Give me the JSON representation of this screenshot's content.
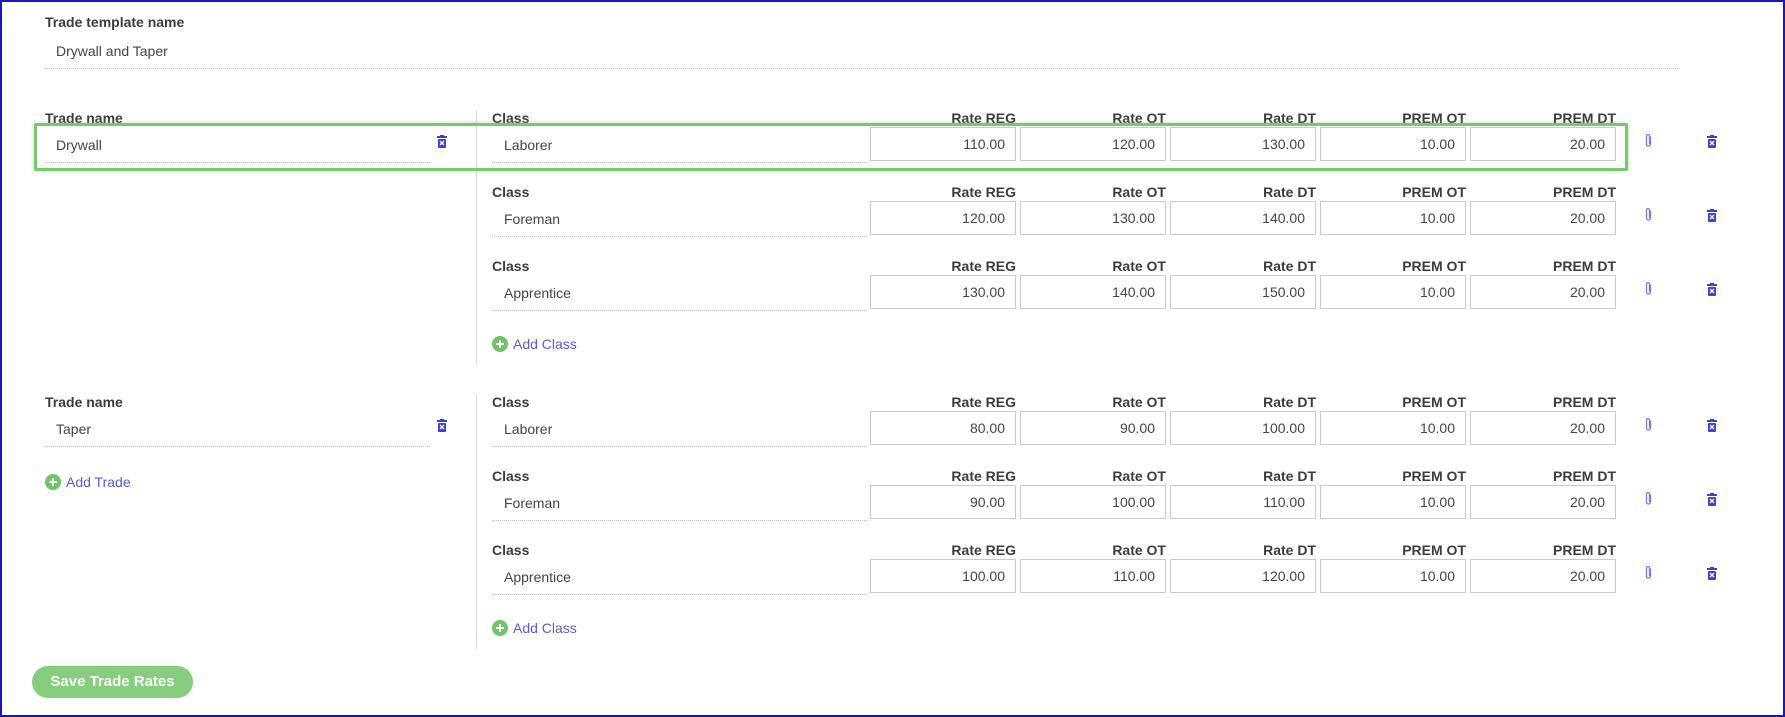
{
  "template": {
    "name_label": "Trade template name",
    "name_value": "Drywall and Taper"
  },
  "labels": {
    "trade_name": "Trade name",
    "class": "Class",
    "rate_reg": "Rate REG",
    "rate_ot": "Rate OT",
    "rate_dt": "Rate DT",
    "prem_ot": "PREM OT",
    "prem_dt": "PREM DT"
  },
  "trades": [
    {
      "name": "Drywall",
      "classes": [
        {
          "name": "Laborer",
          "rate_reg": "110.00",
          "rate_ot": "120.00",
          "rate_dt": "130.00",
          "prem_ot": "10.00",
          "prem_dt": "20.00"
        },
        {
          "name": "Foreman",
          "rate_reg": "120.00",
          "rate_ot": "130.00",
          "rate_dt": "140.00",
          "prem_ot": "10.00",
          "prem_dt": "20.00"
        },
        {
          "name": "Apprentice",
          "rate_reg": "130.00",
          "rate_ot": "140.00",
          "rate_dt": "150.00",
          "prem_ot": "10.00",
          "prem_dt": "20.00"
        }
      ]
    },
    {
      "name": "Taper",
      "classes": [
        {
          "name": "Laborer",
          "rate_reg": "80.00",
          "rate_ot": "90.00",
          "rate_dt": "100.00",
          "prem_ot": "10.00",
          "prem_dt": "20.00"
        },
        {
          "name": "Foreman",
          "rate_reg": "90.00",
          "rate_ot": "100.00",
          "rate_dt": "110.00",
          "prem_ot": "10.00",
          "prem_dt": "20.00"
        },
        {
          "name": "Apprentice",
          "rate_reg": "100.00",
          "rate_ot": "110.00",
          "rate_dt": "120.00",
          "prem_ot": "10.00",
          "prem_dt": "20.00"
        }
      ]
    }
  ],
  "actions": {
    "add_class": "Add Class",
    "add_trade": "Add Trade",
    "save": "Save Trade Rates"
  },
  "icons": {
    "delete": "trash-icon",
    "attach": "paperclip-icon",
    "add": "plus-circle-icon"
  },
  "colors": {
    "accent_green": "#86cd7e",
    "link_blue": "#5a5ad6",
    "icon_blue": "#3f3fd0",
    "frame_blue": "#1a14c8"
  }
}
